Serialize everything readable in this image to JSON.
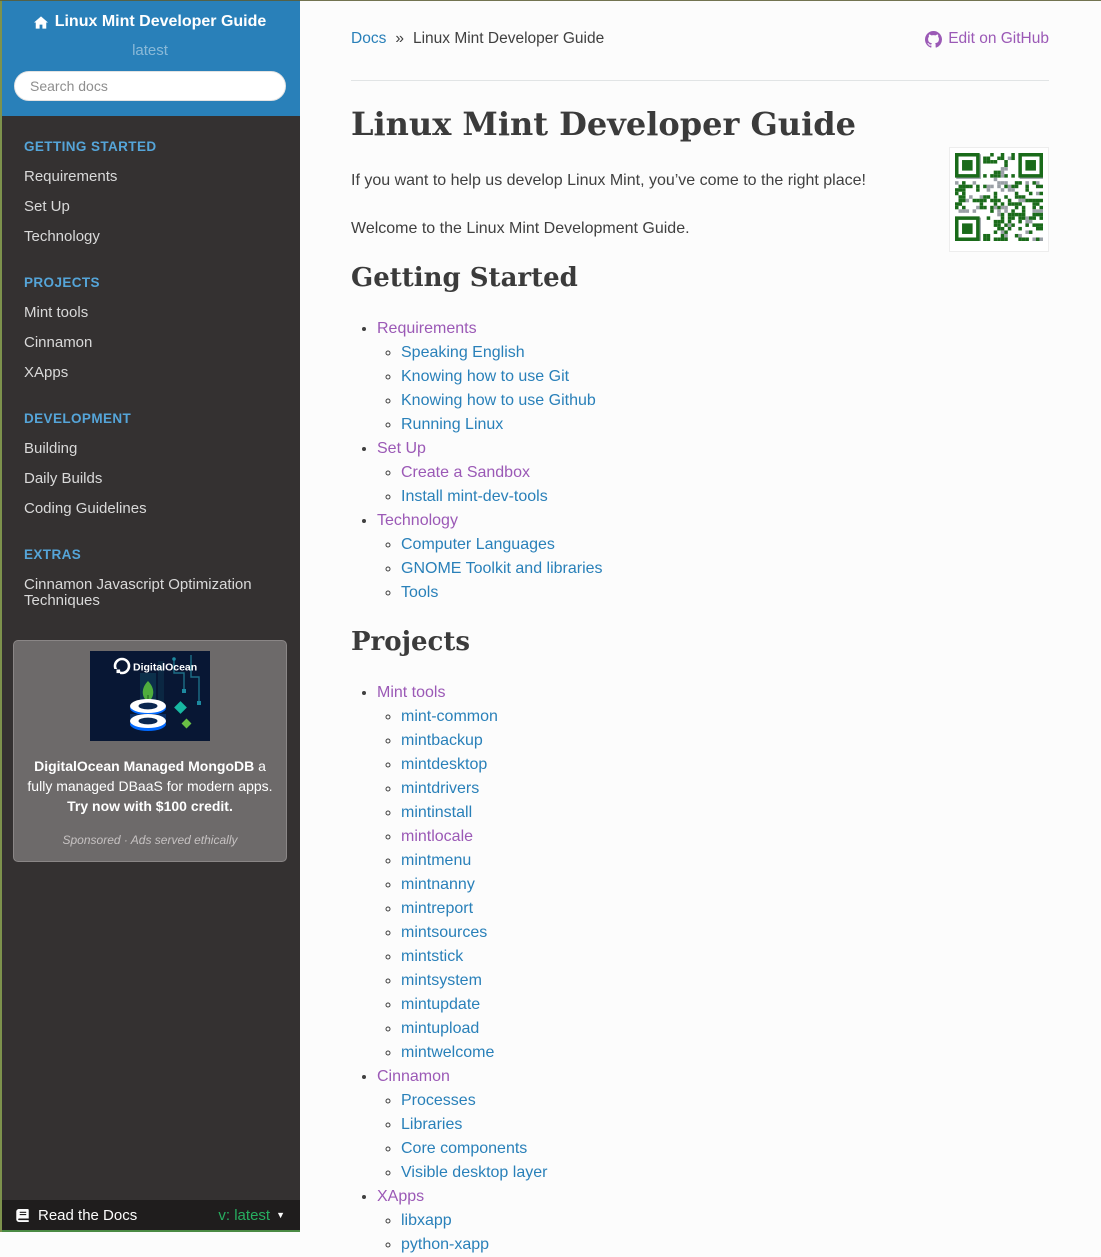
{
  "colors": {
    "header_blue": "#2980b9",
    "sidebar_bg": "#343131",
    "caption_blue": "#55a5d9",
    "link_blue": "#2980b9",
    "link_visited_purple": "#9b59b6",
    "version_green": "#27ae60",
    "qr_green": "#1a6b1a",
    "do_navy": "#081734",
    "do_blue": "#0069ff"
  },
  "sidebar": {
    "title": "Linux Mint Developer Guide",
    "home_icon": "home-icon",
    "version": "latest",
    "search_placeholder": "Search docs",
    "sections": [
      {
        "caption": "GETTING STARTED",
        "items": [
          "Requirements",
          "Set Up",
          "Technology"
        ]
      },
      {
        "caption": "PROJECTS",
        "items": [
          "Mint tools",
          "Cinnamon",
          "XApps"
        ]
      },
      {
        "caption": "DEVELOPMENT",
        "items": [
          "Building",
          "Daily Builds",
          "Coding Guidelines"
        ]
      },
      {
        "caption": "EXTRAS",
        "items": [
          "Cinnamon Javascript Optimization Techniques"
        ]
      }
    ],
    "ad": {
      "brand": "DigitalOcean",
      "headline_bold": "DigitalOcean Managed MongoDB",
      "headline_rest": " a fully managed DBaaS for modern apps. ",
      "cta": "Try now with $100 credit.",
      "disclosure": "Sponsored · Ads served ethically"
    },
    "footer": {
      "label": "Read the Docs",
      "version_label": "v: latest",
      "book_icon": "book-icon",
      "caret_icon": "caret-down-icon"
    }
  },
  "breadcrumb": {
    "docs": "Docs",
    "separator": "»",
    "current": "Linux Mint Developer Guide",
    "edit_label": "Edit on GitHub",
    "edit_icon": "github-icon"
  },
  "main": {
    "title": "Linux Mint Developer Guide",
    "paragraphs": [
      "If you want to help us develop Linux Mint, you’ve come to the right place!",
      "Welcome to the Linux Mint Development Guide."
    ],
    "qr_image": "qr-code-image",
    "sections": [
      {
        "heading": "Getting Started",
        "items": [
          {
            "label": "Requirements",
            "visited": true,
            "children": [
              {
                "label": "Speaking English"
              },
              {
                "label": "Knowing how to use Git"
              },
              {
                "label": "Knowing how to use Github"
              },
              {
                "label": "Running Linux"
              }
            ]
          },
          {
            "label": "Set Up",
            "visited": true,
            "children": [
              {
                "label": "Create a Sandbox",
                "visited": true
              },
              {
                "label": "Install mint-dev-tools"
              }
            ]
          },
          {
            "label": "Technology",
            "visited": true,
            "children": [
              {
                "label": "Computer Languages"
              },
              {
                "label": "GNOME Toolkit and libraries"
              },
              {
                "label": "Tools"
              }
            ]
          }
        ]
      },
      {
        "heading": "Projects",
        "items": [
          {
            "label": "Mint tools",
            "visited": true,
            "children": [
              {
                "label": "mint-common"
              },
              {
                "label": "mintbackup"
              },
              {
                "label": "mintdesktop"
              },
              {
                "label": "mintdrivers"
              },
              {
                "label": "mintinstall"
              },
              {
                "label": "mintlocale",
                "visited": true
              },
              {
                "label": "mintmenu"
              },
              {
                "label": "mintnanny"
              },
              {
                "label": "mintreport"
              },
              {
                "label": "mintsources"
              },
              {
                "label": "mintstick"
              },
              {
                "label": "mintsystem"
              },
              {
                "label": "mintupdate"
              },
              {
                "label": "mintupload"
              },
              {
                "label": "mintwelcome"
              }
            ]
          },
          {
            "label": "Cinnamon",
            "visited": true,
            "children": [
              {
                "label": "Processes"
              },
              {
                "label": "Libraries"
              },
              {
                "label": "Core components"
              },
              {
                "label": "Visible desktop layer"
              }
            ]
          },
          {
            "label": "XApps",
            "visited": true,
            "children": [
              {
                "label": "libxapp"
              },
              {
                "label": "python-xapp"
              }
            ]
          }
        ]
      }
    ]
  }
}
